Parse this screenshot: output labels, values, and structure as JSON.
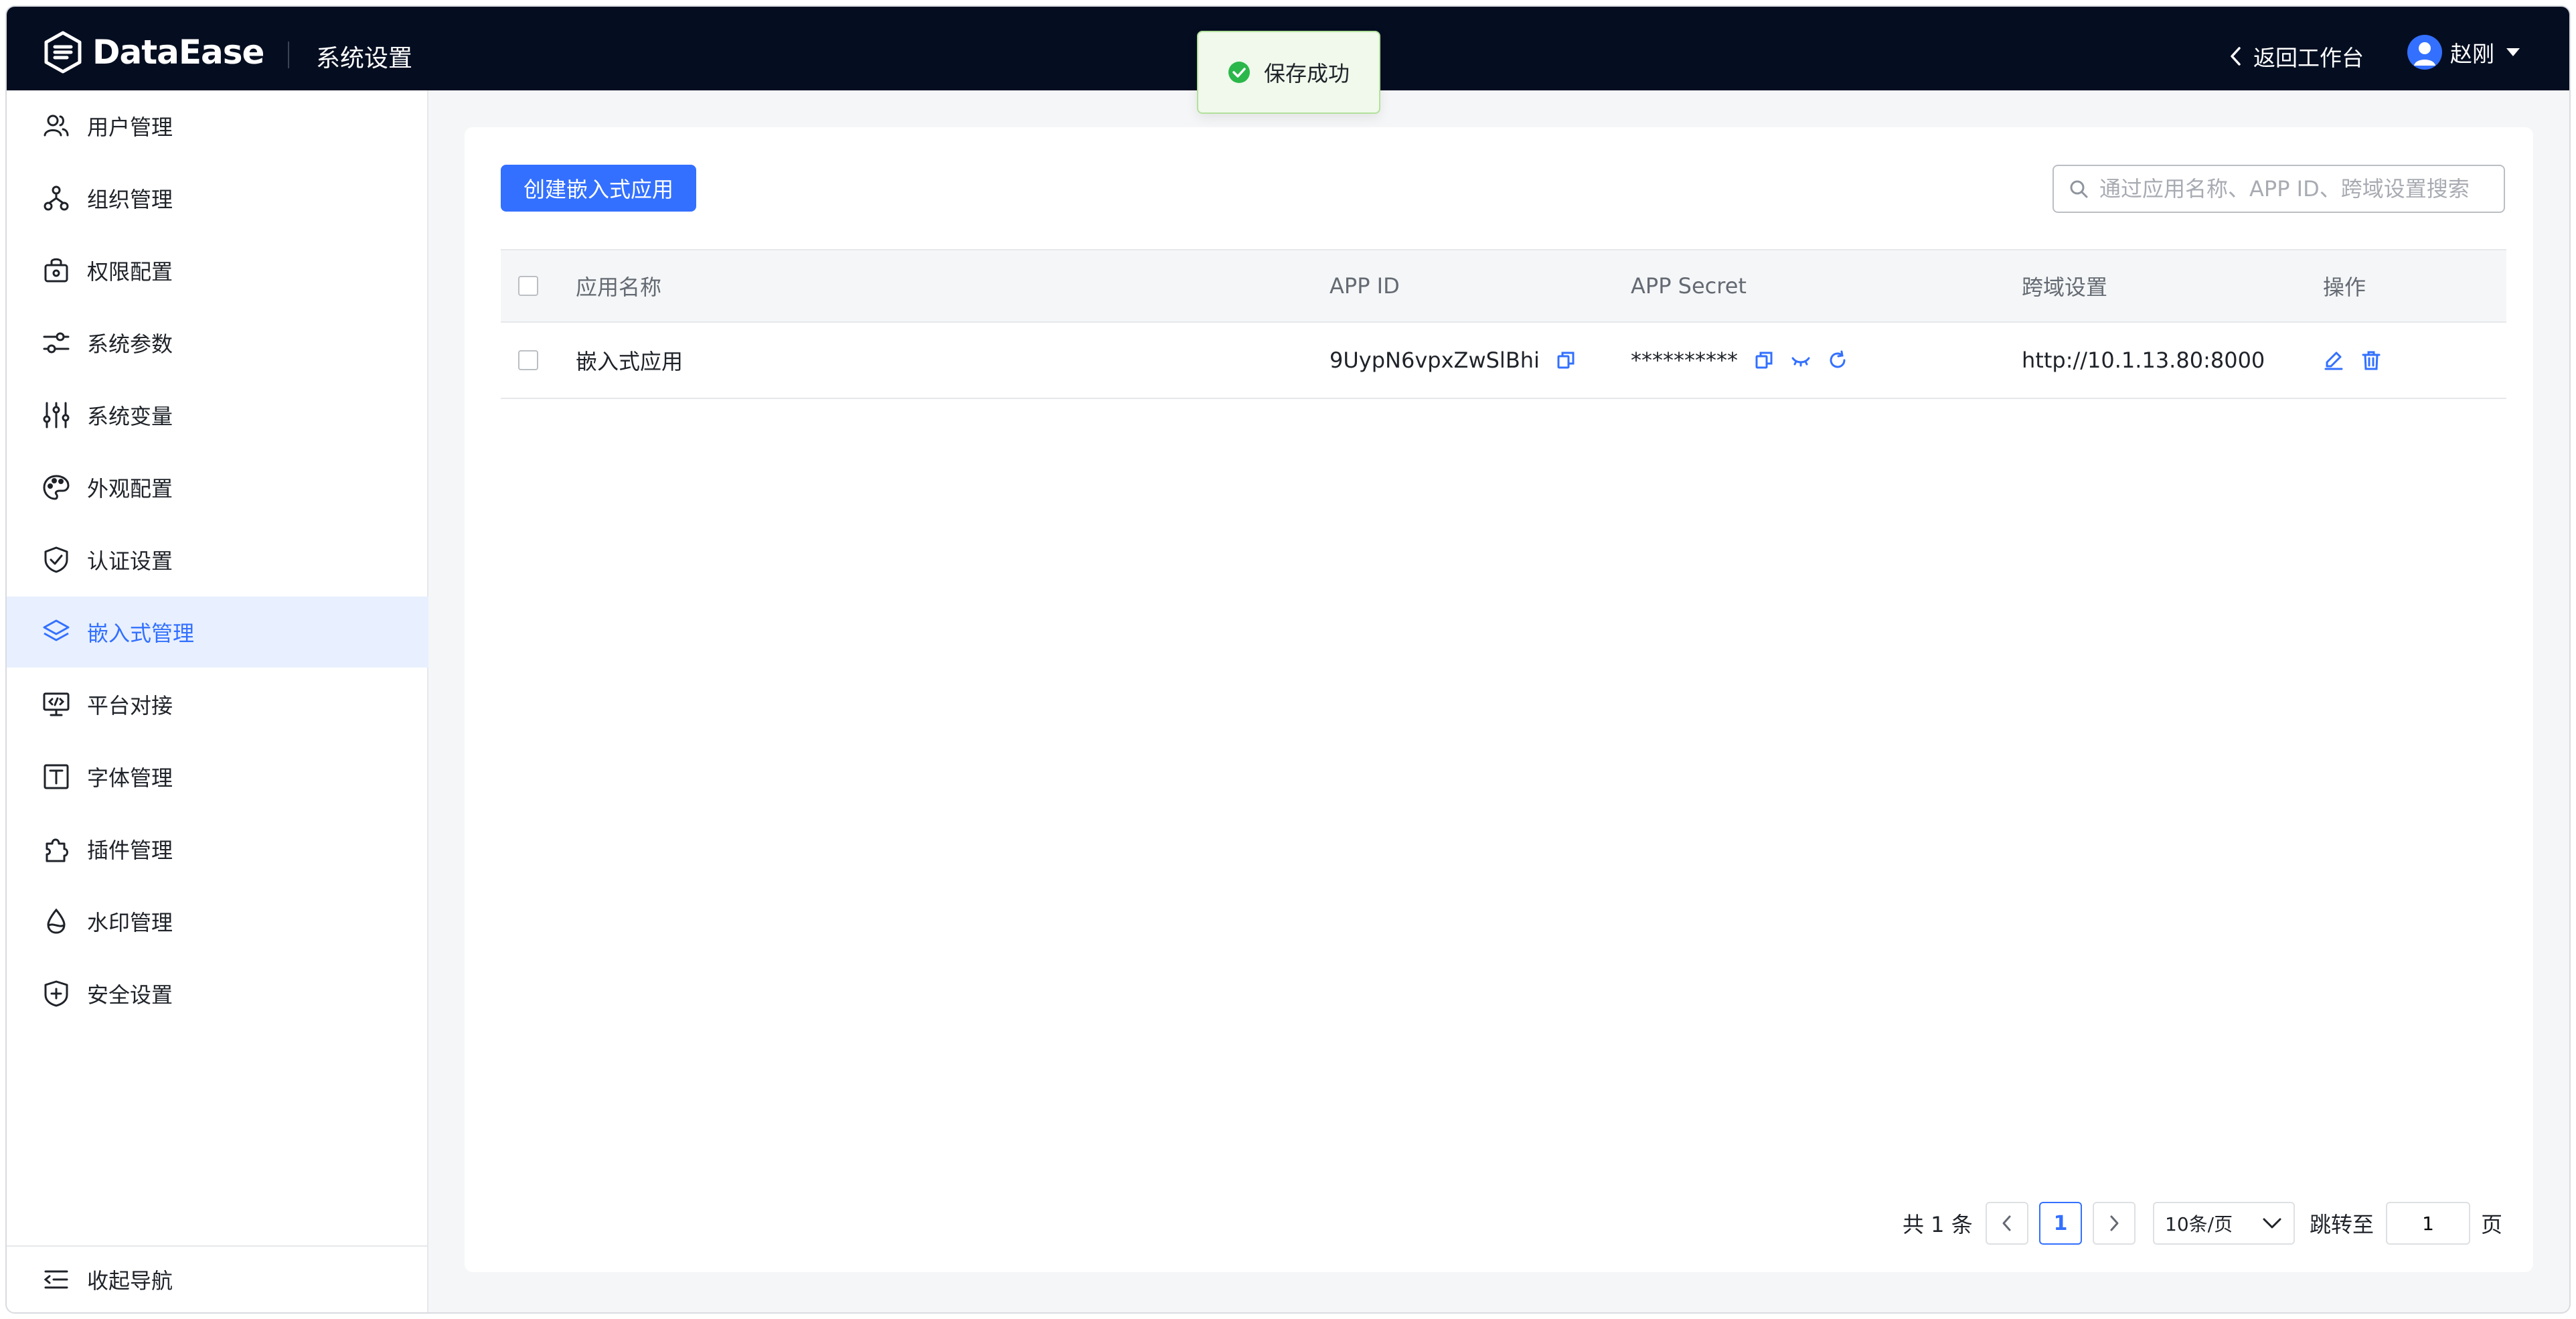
{
  "header": {
    "logo_text": "DataEase",
    "title": "系统设置",
    "back_label": "返回工作台",
    "user_name": "赵刚"
  },
  "toast": {
    "message": "保存成功",
    "type": "success"
  },
  "sidebar": {
    "items": [
      {
        "label": "用户管理",
        "icon": "users-icon",
        "active": false
      },
      {
        "label": "组织管理",
        "icon": "org-tree-icon",
        "active": false
      },
      {
        "label": "权限配置",
        "icon": "lock-bag-icon",
        "active": false
      },
      {
        "label": "系统参数",
        "icon": "sliders-icon",
        "active": false
      },
      {
        "label": "系统变量",
        "icon": "variable-sliders-icon",
        "active": false
      },
      {
        "label": "外观配置",
        "icon": "palette-icon",
        "active": false
      },
      {
        "label": "认证设置",
        "icon": "shield-check-icon",
        "active": false
      },
      {
        "label": "嵌入式管理",
        "icon": "layers-icon",
        "active": true
      },
      {
        "label": "平台对接",
        "icon": "monitor-code-icon",
        "active": false
      },
      {
        "label": "字体管理",
        "icon": "font-icon",
        "active": false
      },
      {
        "label": "插件管理",
        "icon": "puzzle-icon",
        "active": false
      },
      {
        "label": "水印管理",
        "icon": "droplet-icon",
        "active": false
      },
      {
        "label": "安全设置",
        "icon": "shield-plus-icon",
        "active": false
      }
    ],
    "collapse_label": "收起导航"
  },
  "main": {
    "create_button": "创建嵌入式应用",
    "search_placeholder": "通过应用名称、APP ID、跨域设置搜索",
    "columns": [
      "应用名称",
      "APP ID",
      "APP Secret",
      "跨域设置",
      "操作"
    ],
    "rows": [
      {
        "name": "嵌入式应用",
        "app_id": "9UypN6vpxZwSlBhi",
        "app_secret": "**********",
        "cors": "http://10.1.13.80:8000"
      }
    ]
  },
  "pagination": {
    "total_text": "共 1 条",
    "current_page": "1",
    "page_size": "10条/页",
    "jump_label": "跳转至",
    "jump_value": "1",
    "page_unit": "页"
  },
  "colors": {
    "accent": "#3370ff",
    "header_bg": "#050e21",
    "success": "#2bb74a",
    "active_bg": "#e8f0ff"
  }
}
